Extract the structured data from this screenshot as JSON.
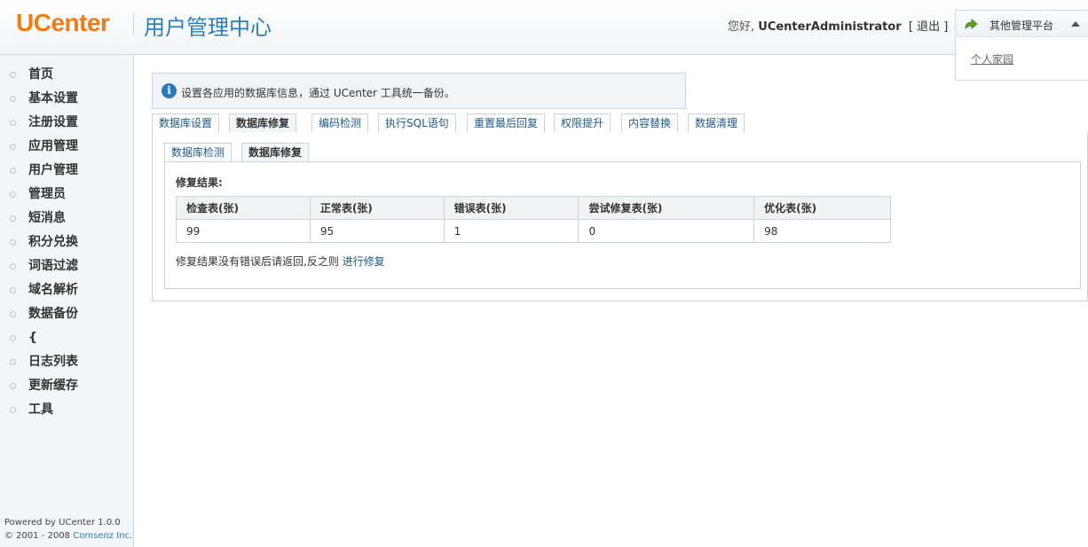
{
  "header": {
    "logo_u": "U",
    "logo_rest": "Center",
    "title": "用户管理中心",
    "greeting_prefix": "您好, ",
    "username": "UCenterAdministrator",
    "logout_label": "[ 退出 ]"
  },
  "platforms": {
    "label": "其他管理平台",
    "items": [
      "个人家园"
    ]
  },
  "sidebar": {
    "items": [
      {
        "label": "首页"
      },
      {
        "label": "基本设置"
      },
      {
        "label": "注册设置"
      },
      {
        "label": "应用管理"
      },
      {
        "label": "用户管理"
      },
      {
        "label": "管理员"
      },
      {
        "label": "短消息"
      },
      {
        "label": "积分兑换"
      },
      {
        "label": "词语过滤"
      },
      {
        "label": "域名解析"
      },
      {
        "label": "数据备份"
      },
      {
        "label": "{"
      },
      {
        "label": "日志列表"
      },
      {
        "label": "更新缓存"
      },
      {
        "label": "工具"
      }
    ],
    "footer_powered": "Powered by UCenter 1.0.0",
    "footer_copyright": "© 2001 - 2008 ",
    "footer_company": "Comsenz Inc."
  },
  "info": {
    "icon": "info-icon",
    "text": "设置各应用的数据库信息，通过 UCenter 工具统一备份。"
  },
  "outer_tabs": [
    {
      "label": "数据库设置",
      "active": false
    },
    {
      "label": "数据库修复",
      "active": true
    },
    {
      "label": "编码检测",
      "active": false
    },
    {
      "label": "执行SQL语句",
      "active": false
    },
    {
      "label": "重置最后回复",
      "active": false
    },
    {
      "label": "权限提升",
      "active": false
    },
    {
      "label": "内容替换",
      "active": false
    },
    {
      "label": "数据清理",
      "active": false
    }
  ],
  "inner_tabs": [
    {
      "label": "数据库检测",
      "active": false
    },
    {
      "label": "数据库修复",
      "active": true
    }
  ],
  "result": {
    "title": "修复结果:",
    "columns": [
      "检查表(张)",
      "正常表(张)",
      "错误表(张)",
      "尝试修复表(张)",
      "优化表(张)"
    ],
    "row": [
      "99",
      "95",
      "1",
      "0",
      "98"
    ],
    "note": "修复结果没有错误后请返回,反之则 ",
    "note_link": "进行修复"
  },
  "colors": {
    "brand_orange": "#f07c15",
    "title_blue": "#2a7fbf",
    "link_blue": "#1c5a94",
    "border": "#c9d4dd"
  }
}
